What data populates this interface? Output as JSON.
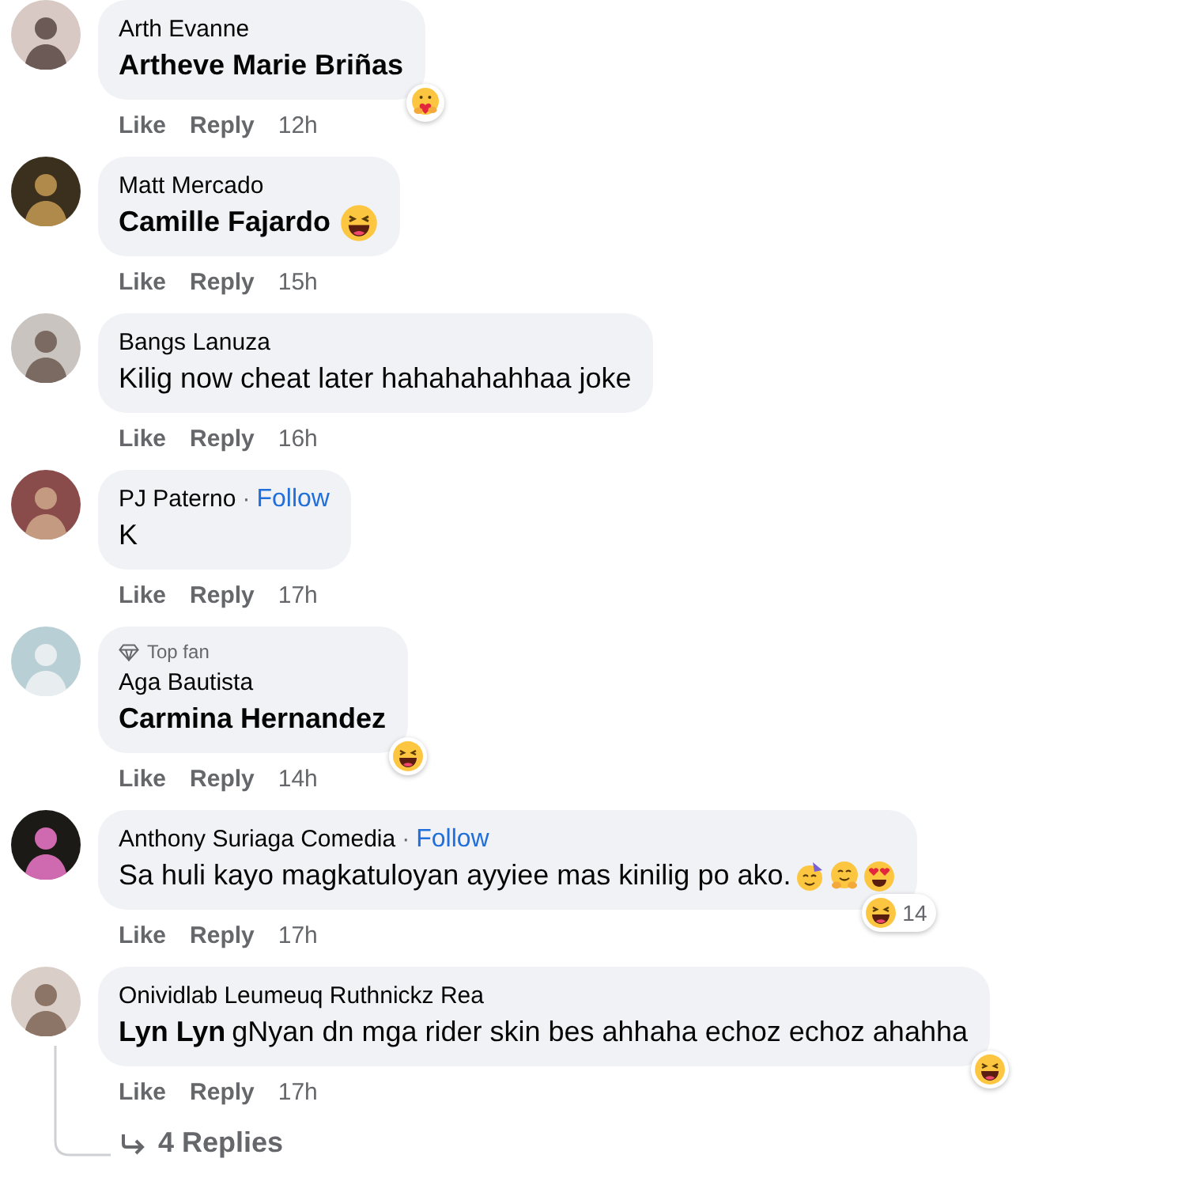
{
  "comments": [
    {
      "author": "Arth Evanne",
      "mention": "Artheve Marie Briñas",
      "actions": [
        "Like",
        "Reply"
      ],
      "time": "12h",
      "reaction": {
        "kind": "care"
      }
    },
    {
      "author": "Matt Mercado",
      "mention": "Camille Fajardo",
      "actions": [
        "Like",
        "Reply"
      ],
      "time": "15h",
      "inline_reaction": {
        "kind": "haha"
      }
    },
    {
      "author": "Bangs Lanuza",
      "text": "Kilig now cheat later hahahahahhaa joke",
      "actions": [
        "Like",
        "Reply"
      ],
      "time": "16h"
    },
    {
      "author": "PJ Paterno",
      "separator": "·",
      "follow": "Follow",
      "text": "K",
      "actions": [
        "Like",
        "Reply"
      ],
      "time": "17h"
    },
    {
      "badge": "Top fan",
      "author": "Aga Bautista",
      "mention": "Carmina Hernandez",
      "actions": [
        "Like",
        "Reply"
      ],
      "time": "14h",
      "reaction": {
        "kind": "haha"
      }
    },
    {
      "author": "Anthony Suriaga Comedia",
      "separator": "·",
      "follow": "Follow",
      "text": "Sa huli kayo magkatuloyan ayyiee mas kinilig po ako.",
      "emojis": [
        {
          "kind": "party"
        },
        {
          "kind": "hug"
        },
        {
          "kind": "heart-eyes"
        }
      ],
      "actions": [
        "Like",
        "Reply"
      ],
      "time": "17h",
      "reaction": {
        "kind": "haha",
        "count": "14"
      }
    },
    {
      "author": "Onividlab Leumeuq Ruthnickz Rea",
      "mention": "Lyn Lyn",
      "text": "gNyan dn mga rider skin bes ahhaha echoz echoz ahahha",
      "actions": [
        "Like",
        "Reply"
      ],
      "time": "17h",
      "reaction": {
        "kind": "haha"
      },
      "replies": "4 Replies"
    }
  ]
}
